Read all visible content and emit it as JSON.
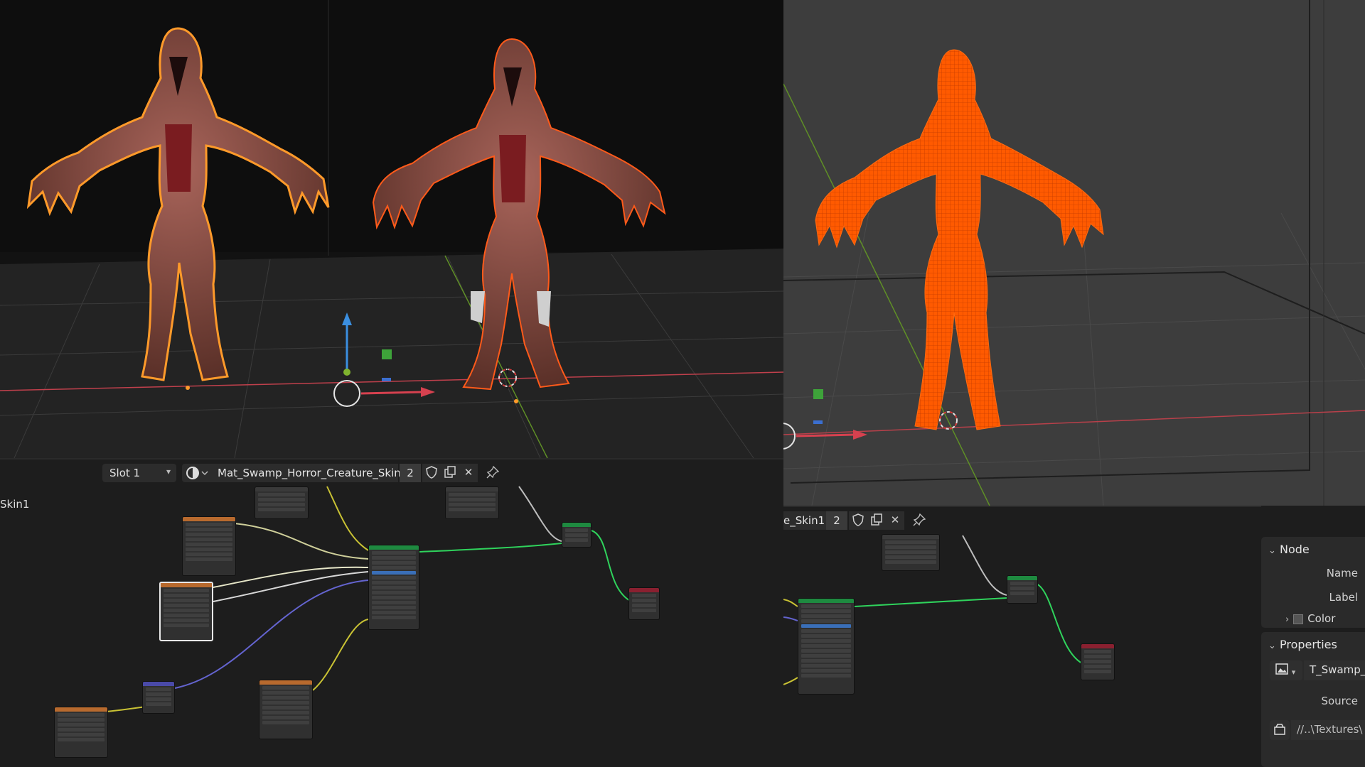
{
  "node_header": {
    "slot_label": "Slot 1",
    "material_name": "Mat_Swamp_Horror_Creature_Skin1",
    "user_count": "2",
    "partial_label": "Skin1"
  },
  "node_header_right": {
    "material_name_partial": "e_Skin1",
    "user_count": "2"
  },
  "sidebar": {
    "node_panel_title": "Node",
    "name_label": "Name",
    "label_label": "Label",
    "color_label": "Color",
    "properties_panel_title": "Properties",
    "image_name": "T_Swamp_",
    "source_label": "Source",
    "path_value": "//..\\Textures\\"
  },
  "icons": {
    "slot_chevron": "chevron-down-icon",
    "material_browse": "material-sphere-icon",
    "fake_user": "shield-icon",
    "duplicate": "duplicate-icon",
    "unlink": "close-icon",
    "pin": "pin-icon",
    "panel_expand": "chevron-down-icon",
    "color_expand": "chevron-right-icon",
    "image_browse": "image-icon",
    "file_pack": "package-icon"
  },
  "colors": {
    "selection_outline": "#ff8a1c",
    "wireframe": "#ff5a00",
    "x_axis": "#d6414f",
    "y_axis": "#7fb32e",
    "z_axis": "#3b8fe0",
    "link_yellow": "#c9c234",
    "link_green": "#2fd35c",
    "link_purple": "#6464d0",
    "link_gray": "#bdbdbd"
  }
}
